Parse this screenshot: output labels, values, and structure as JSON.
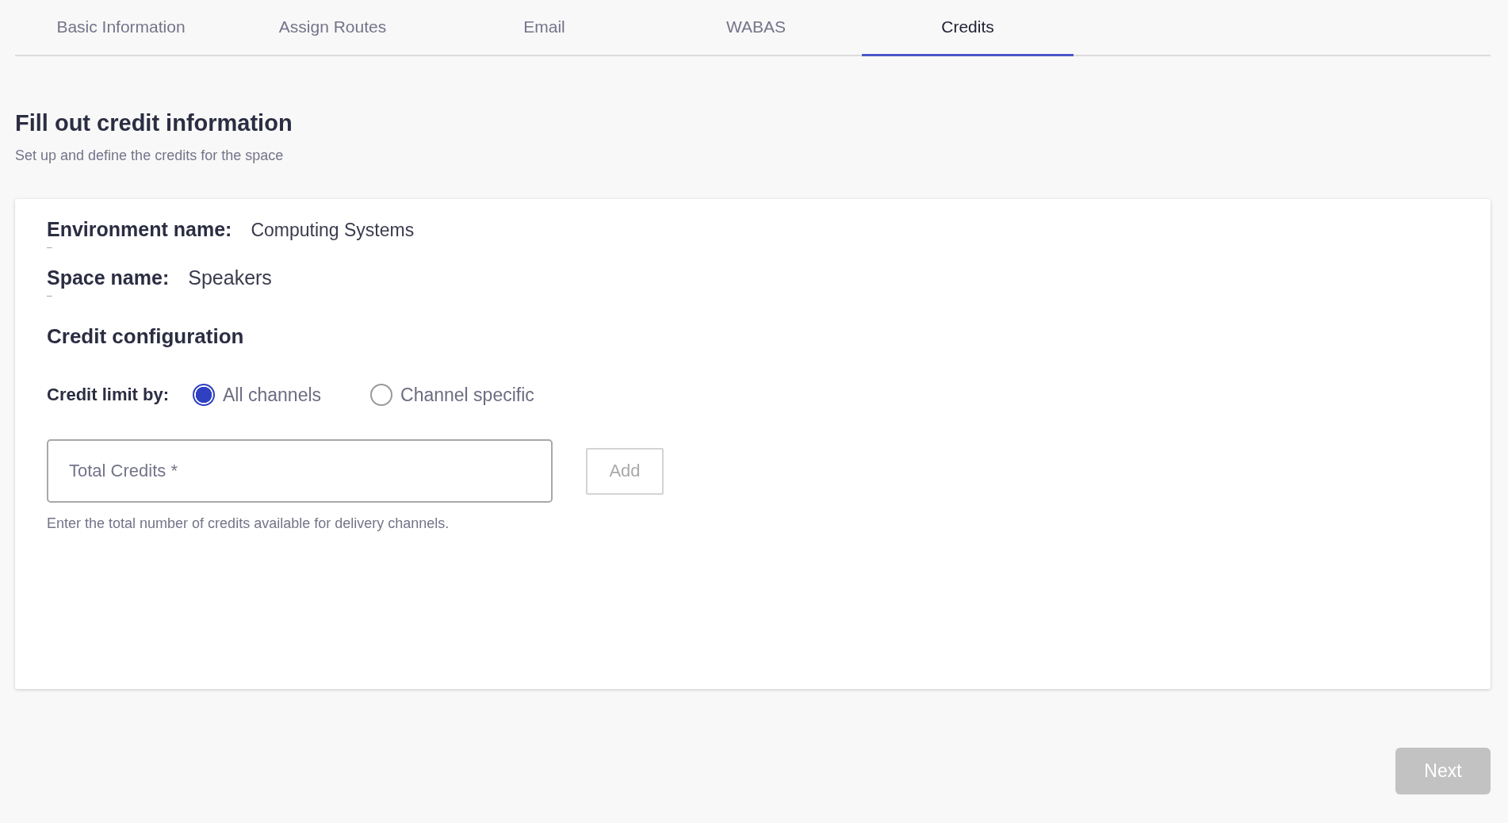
{
  "tabs": [
    {
      "label": "Basic Information",
      "selected": false
    },
    {
      "label": "Assign Routes",
      "selected": false
    },
    {
      "label": "Email",
      "selected": false
    },
    {
      "label": "WABAS",
      "selected": false
    },
    {
      "label": "Credits",
      "selected": true
    }
  ],
  "header": {
    "title": "Fill out credit information",
    "subtitle": "Set up and define the credits for the space"
  },
  "details": [
    {
      "label": "Environment name:",
      "value": "Computing Systems",
      "marker": "–"
    },
    {
      "label": "Space name:",
      "value": "Speakers",
      "marker": "–"
    }
  ],
  "credit_configuration": {
    "title": "Credit configuration",
    "limit_label": "Credit limit by:",
    "options": [
      {
        "label": "All channels",
        "selected": true
      },
      {
        "label": "Channel specific",
        "selected": false
      }
    ],
    "total_credits": {
      "placeholder": "Total Credits *",
      "helper": "Enter the total number of credits available for delivery channels."
    },
    "add_button": {
      "label": "Add",
      "disabled": true
    }
  },
  "next_button": {
    "label": "Next",
    "disabled": true
  }
}
